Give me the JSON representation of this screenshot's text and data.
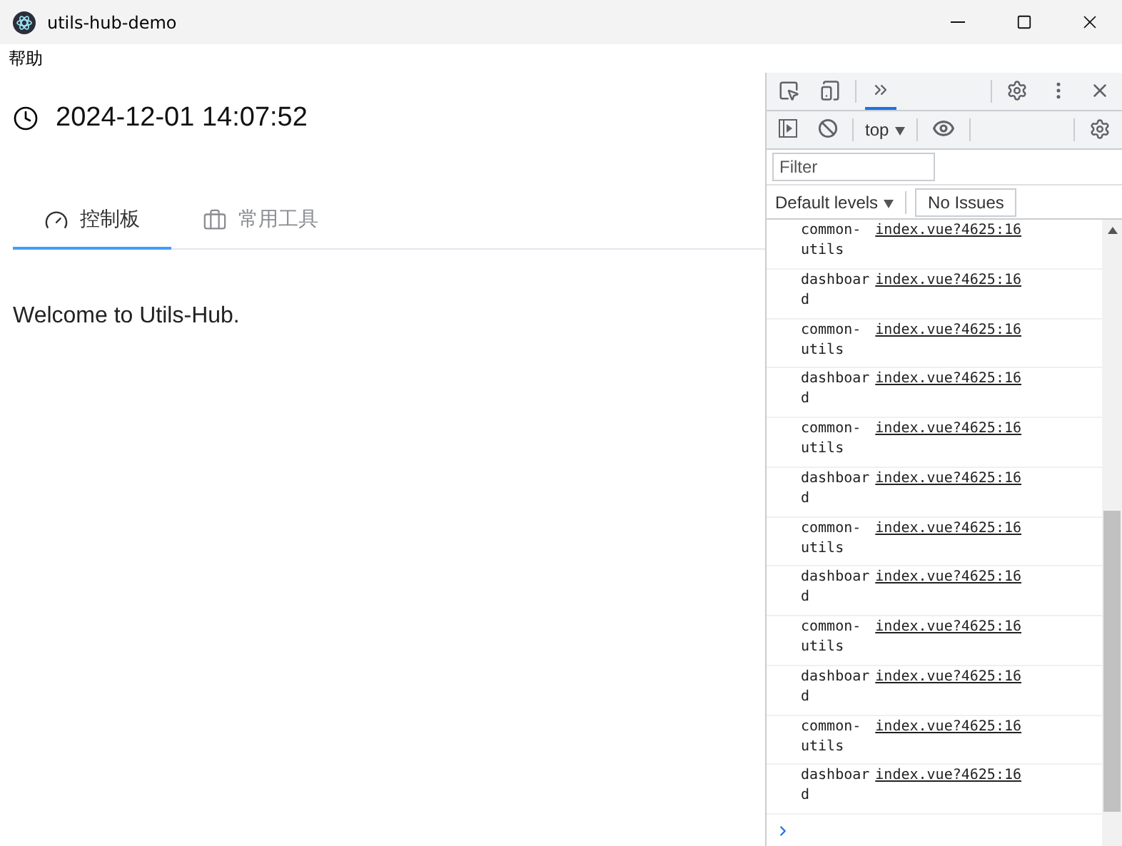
{
  "window": {
    "title": "utils-hub-demo"
  },
  "menu": [
    "帮助"
  ],
  "clock": {
    "datetime": "2024-12-01 14:07:52"
  },
  "tabs": [
    {
      "label": "控制板",
      "kind": "dashboard",
      "selected": true
    },
    {
      "label": "常用工具",
      "kind": "tools",
      "selected": false
    }
  ],
  "content": {
    "text": "Welcome to Utils-Hub."
  },
  "devtools": {
    "context": "top",
    "filter": {
      "placeholder": "Filter"
    },
    "levels": "Default levels",
    "issues": "No Issues",
    "messages": [
      {
        "text": "common-utils",
        "source": "index.vue?4625:16"
      },
      {
        "text": "dashboard",
        "source": "index.vue?4625:16"
      },
      {
        "text": "common-utils",
        "source": "index.vue?4625:16"
      },
      {
        "text": "dashboard",
        "source": "index.vue?4625:16"
      },
      {
        "text": "common-utils",
        "source": "index.vue?4625:16"
      },
      {
        "text": "dashboard",
        "source": "index.vue?4625:16"
      },
      {
        "text": "common-utils",
        "source": "index.vue?4625:16"
      },
      {
        "text": "dashboard",
        "source": "index.vue?4625:16"
      },
      {
        "text": "common-utils",
        "source": "index.vue?4625:16"
      },
      {
        "text": "dashboard",
        "source": "index.vue?4625:16"
      },
      {
        "text": "common-utils",
        "source": "index.vue?4625:16"
      },
      {
        "text": "dashboard",
        "source": "index.vue?4625:16"
      }
    ]
  }
}
